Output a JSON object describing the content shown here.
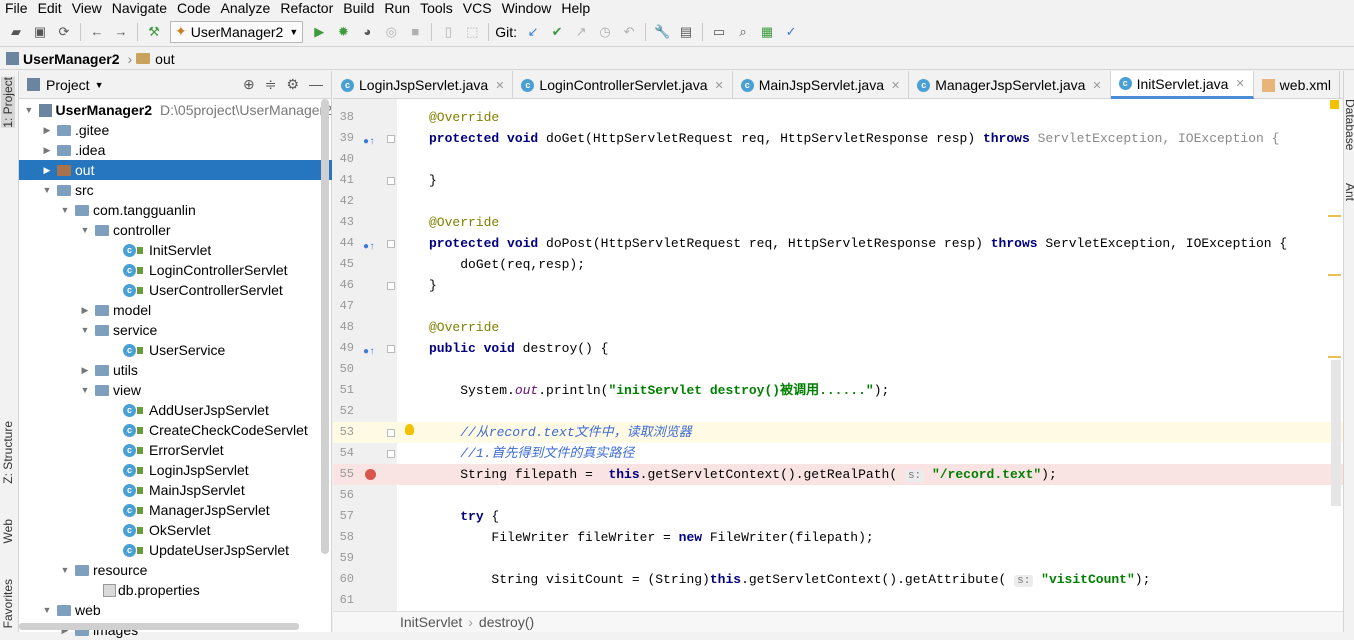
{
  "menu": [
    "File",
    "Edit",
    "View",
    "Navigate",
    "Code",
    "Analyze",
    "Refactor",
    "Build",
    "Run",
    "Tools",
    "VCS",
    "Window",
    "Help"
  ],
  "toolbar": {
    "run_config": "UserManager2",
    "git_label": "Git:"
  },
  "breadcrumb": {
    "project": "UserManager2",
    "folder": "out"
  },
  "left_tabs": {
    "project": "1: Project",
    "structure": "Z: Structure",
    "web": "Web",
    "favorites": "Favorites"
  },
  "right_tabs": {
    "database": "Database",
    "ant": "Ant"
  },
  "project_panel": {
    "title": "Project",
    "root_name": "UserManager2",
    "root_path": "D:\\05project\\UserManager2",
    "items": [
      {
        "label": "UserManager2"
      },
      {
        "label": ".gitee"
      },
      {
        "label": ".idea"
      },
      {
        "label": "out"
      },
      {
        "label": "src"
      },
      {
        "label": "com.tangguanlin"
      },
      {
        "label": "controller"
      },
      {
        "label": "InitServlet"
      },
      {
        "label": "LoginControllerServlet"
      },
      {
        "label": "UserControllerServlet"
      },
      {
        "label": "model"
      },
      {
        "label": "service"
      },
      {
        "label": "UserService"
      },
      {
        "label": "utils"
      },
      {
        "label": "view"
      },
      {
        "label": "AddUserJspServlet"
      },
      {
        "label": "CreateCheckCodeServlet"
      },
      {
        "label": "ErrorServlet"
      },
      {
        "label": "LoginJspServlet"
      },
      {
        "label": "MainJspServlet"
      },
      {
        "label": "ManagerJspServlet"
      },
      {
        "label": "OkServlet"
      },
      {
        "label": "UpdateUserJspServlet"
      },
      {
        "label": "resource"
      },
      {
        "label": "db.properties"
      },
      {
        "label": "web"
      },
      {
        "label": "images"
      }
    ]
  },
  "tabs": [
    {
      "label": "LoginJspServlet.java"
    },
    {
      "label": "LoginControllerServlet.java"
    },
    {
      "label": "MainJspServlet.java"
    },
    {
      "label": "ManagerJspServlet.java"
    },
    {
      "label": "InitServlet.java"
    },
    {
      "label": "web.xml"
    }
  ],
  "code": {
    "lines": [
      "38",
      "39",
      "40",
      "41",
      "42",
      "43",
      "44",
      "45",
      "46",
      "47",
      "48",
      "49",
      "50",
      "51",
      "52",
      "53",
      "54",
      "55",
      "56",
      "57",
      "58",
      "59",
      "60",
      "61"
    ],
    "override": "@Override",
    "kw_protected": "protected",
    "kw_void": "void",
    "kw_public": "public",
    "kw_throws": "throws",
    "kw_this": "this",
    "kw_try": "try",
    "kw_new": "new",
    "doget_sig": " doGet(HttpServletRequest req, HttpServletResponse resp) ",
    "doget_ex": "ServletException, IOException {",
    "close_brace": "}",
    "dopost_sig": " doPost(HttpServletRequest req, HttpServletResponse resp) ",
    "dopost_ex": " ServletException, IOException {",
    "doget_call": "doGet(req,resp);",
    "destroy_sig": " destroy() {",
    "println_pre": "System.",
    "println_out": "out",
    "println_post": ".println(",
    "println_str": "\"initServlet destroy()被调用......\"",
    "println_end": ");",
    "comment1": "//从record.text文件中，读取浏览器",
    "comment2": "//1.首先得到文件的真实路径",
    "filepath_pre": "String filepath =  ",
    "filepath_mid": ".getServletContext().getRealPath(",
    "hint_s": "s:",
    "filepath_str": "\"/record.text\"",
    "try_brace": " {",
    "fw_pre": "FileWriter fileWriter = ",
    "fw_post": " FileWriter(filepath);",
    "vc_pre": "String visitCount = (String)",
    "vc_mid": ".getServletContext().getAttribute(",
    "vc_str": "\"visitCount\""
  },
  "bottom_breadcrumb": {
    "cls": "InitServlet",
    "method": "destroy()"
  }
}
